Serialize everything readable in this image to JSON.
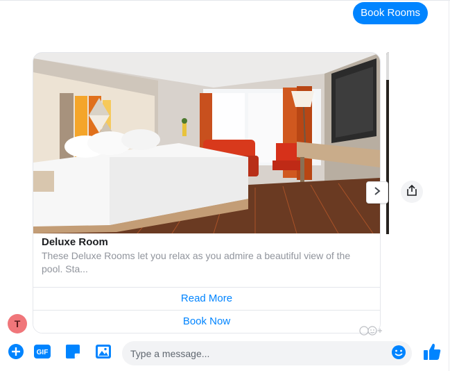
{
  "conversation": {
    "user_message": "Book Rooms",
    "bot_avatar_initial": "T"
  },
  "card": {
    "image_alt": "Hotel room with king bed, orange armchairs and desk",
    "title": "Deluxe Room",
    "subtitle": "These Deluxe Rooms let you relax as you admire a beautiful view of the pool. Sta...",
    "buttons": [
      {
        "label": "Read More"
      },
      {
        "label": "Book Now"
      }
    ]
  },
  "composer": {
    "placeholder": "Type a message...",
    "gif_label": "GIF"
  },
  "icons": {
    "add": "plus-circle-icon",
    "gif": "gif-icon",
    "sticker": "sticker-icon",
    "image": "image-icon",
    "emoji": "smiley-icon",
    "like": "thumbs-up-icon",
    "next": "chevron-right-icon",
    "share": "share-icon",
    "reaction": "add-reaction-icon"
  },
  "colors": {
    "accent": "#0084ff",
    "avatar": "#f0767a",
    "input_bg": "#f2f3f5"
  }
}
